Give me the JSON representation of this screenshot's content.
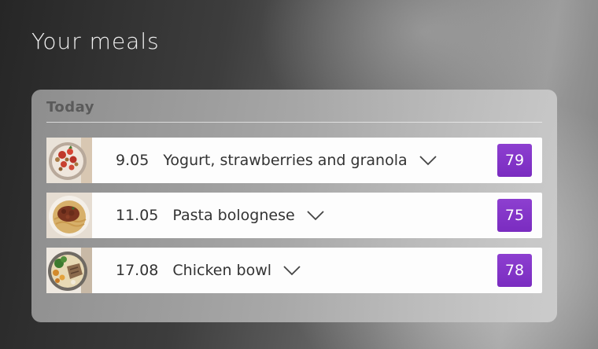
{
  "page": {
    "title": "Your meals"
  },
  "section": {
    "header": "Today"
  },
  "meals": [
    {
      "time": "9.05",
      "name": "Yogurt, strawberries and granola",
      "score": "79",
      "thumb_icon": "yogurt-bowl-photo"
    },
    {
      "time": "11.05",
      "name": "Pasta bolognese",
      "score": "75",
      "thumb_icon": "pasta-plate-photo"
    },
    {
      "time": "17.08",
      "name": "Chicken bowl",
      "score": "78",
      "thumb_icon": "chicken-bowl-photo"
    }
  ],
  "colors": {
    "score_badge": "#7d31c4",
    "row_background": "#fdfdfd",
    "text": "#333333"
  }
}
